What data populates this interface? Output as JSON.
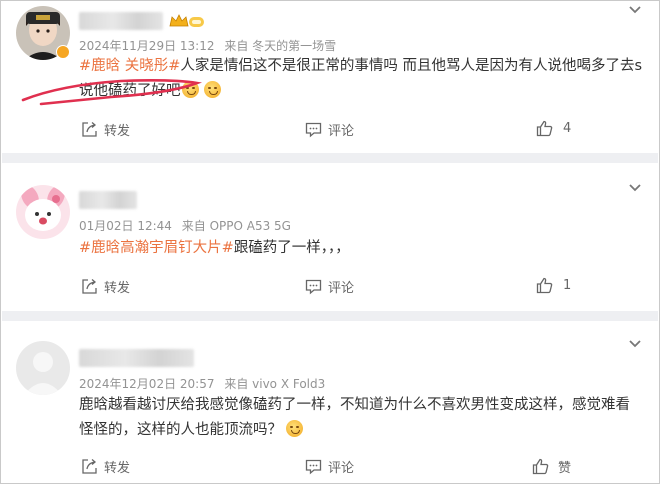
{
  "posts": [
    {
      "meta": {
        "date": "2024年11月29日 13:12",
        "source": "来自 冬天的第一场雪"
      },
      "content": {
        "line1_tag": "#鹿晗 关晓彤#",
        "line1_text": "人家是情侣这不是很正常的事情吗 而且他骂人是因为有人说他喝多了去s",
        "line2_text": "说他磕药了好吧"
      },
      "actions": {
        "repost": "转发",
        "comment": "评论",
        "like": "4"
      }
    },
    {
      "meta": {
        "date": "01月02日 12:44",
        "source": "来自 OPPO A53 5G"
      },
      "content": {
        "line1_tag": "#鹿晗高瀚宇眉钉大片#",
        "line1_text": "跟磕药了一样，，，"
      },
      "actions": {
        "repost": "转发",
        "comment": "评论",
        "like": "1"
      }
    },
    {
      "meta": {
        "date": "2024年12月02日 20:57",
        "source": "来自 vivo X Fold3"
      },
      "content": {
        "line1_text": "鹿晗越看越讨厌给我感觉像磕药了一样，不知道为什么不喜欢男性变成这样，感觉难看",
        "line2_text": "怪怪的，这样的人也能顶流吗？"
      },
      "actions": {
        "repost": "转发",
        "comment": "评论",
        "like": "赞"
      }
    }
  ],
  "colors": {
    "tag": "#eb7340",
    "meta": "#939393",
    "separator": "#eeeff2",
    "annotation": "#e0304f"
  },
  "icons": [
    "repost-icon",
    "comment-icon",
    "like-icon",
    "chevron-down-icon",
    "crown-badge-icon",
    "emoji-icon"
  ]
}
